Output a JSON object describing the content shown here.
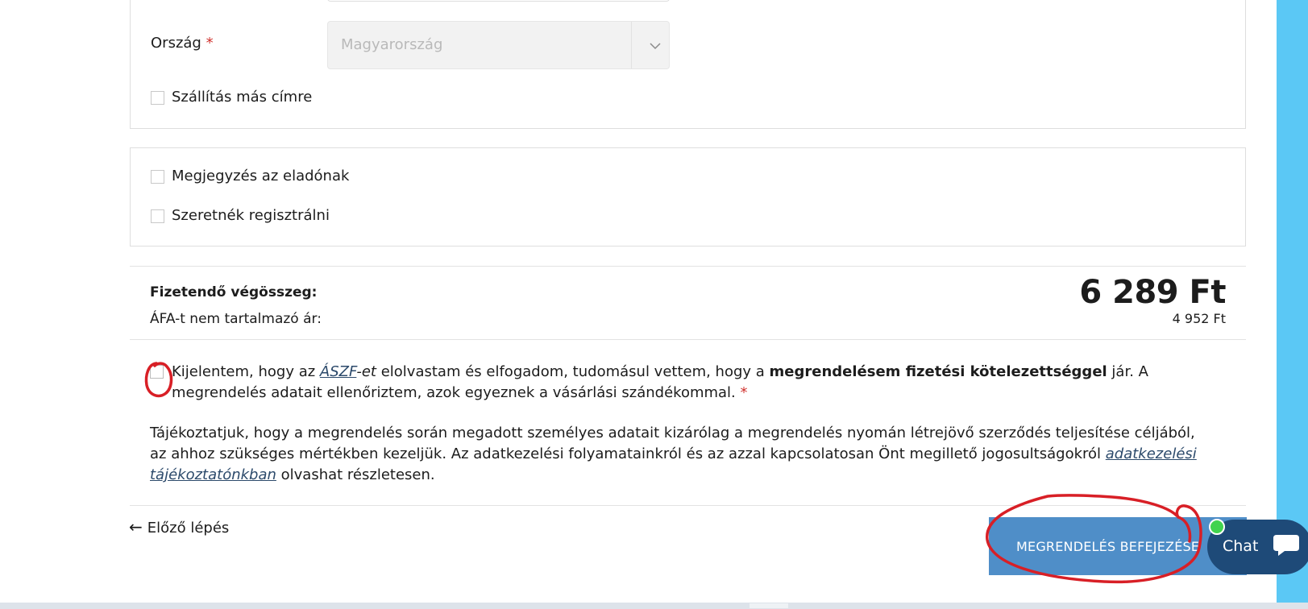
{
  "form": {
    "country_label": "Ország",
    "required_mark": "*",
    "country_value": "Magyarország",
    "ship_other_label": "Szállítás más címre",
    "note_label": "Megjegyzés az eladónak",
    "register_label": "Szeretnék regisztrálni"
  },
  "summary": {
    "total_label": "Fizetendő végösszeg:",
    "net_label": "ÁFA-t nem tartalmazó ár:",
    "total_value": "6 289 Ft",
    "net_value": "4 952 Ft"
  },
  "consent": {
    "t1": "Kijelentem, hogy az ",
    "link": "ÁSZF",
    "t2": "-et",
    "t3": " elolvastam és elfogadom, tudomásul vettem, hogy a ",
    "bold": "megrendelésem fizetési kötelezettséggel",
    "t4": " jár. A megrendelés adatait ellenőriztem, azok egyeznek a vásárlási szándékommal. ",
    "required_mark": "*"
  },
  "info": {
    "text": "Tájékoztatjuk, hogy a megrendelés során megadott személyes adatait kizárólag a megrendelés nyomán létrejövő szerződés teljesítése céljából, az ahhoz szükséges mértékben kezeljük. Az adatkezelési folyamatainkról és az azzal kapcsolatosan Önt megillető jogosultságokról ",
    "link": "adatkezelési tájékoztatónkban",
    "after": " olvashat részletesen."
  },
  "nav": {
    "prev_arrow": "←",
    "prev_label": "Előző lépés",
    "submit_label": "MEGRENDELÉS BEFEJEZÉSE"
  },
  "chat": {
    "label": "Chat",
    "icon": "chat-bubble-icon",
    "status_color": "#41d34e"
  },
  "colors": {
    "accent_button": "#4f8ec8",
    "chat_bg": "#1e4a78",
    "side_band": "#5bc8f5",
    "annotation": "#d81f26"
  }
}
